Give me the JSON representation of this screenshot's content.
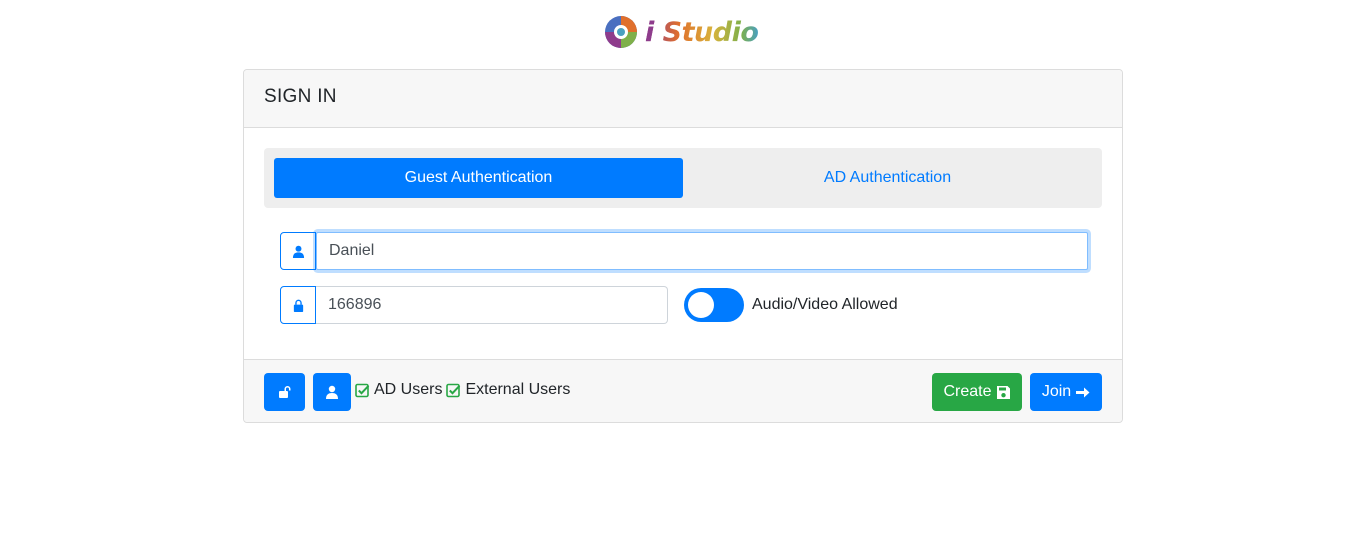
{
  "brand": {
    "logo_prefix": "i",
    "logo_name": "Studio"
  },
  "card": {
    "title": "SIGN IN"
  },
  "tabs": [
    {
      "label": "Guest Authentication",
      "active": true
    },
    {
      "label": "AD Authentication",
      "active": false
    }
  ],
  "form": {
    "name_value": "Daniel",
    "code_value": "166896",
    "av_toggle_label": "Audio/Video Allowed",
    "av_toggle_on": true
  },
  "footer": {
    "ad_users_label": "AD Users",
    "external_users_label": "External Users",
    "create_label": "Create",
    "join_label": "Join"
  },
  "colors": {
    "primary": "#007bff",
    "success": "#28a745",
    "check": "#28a745"
  }
}
